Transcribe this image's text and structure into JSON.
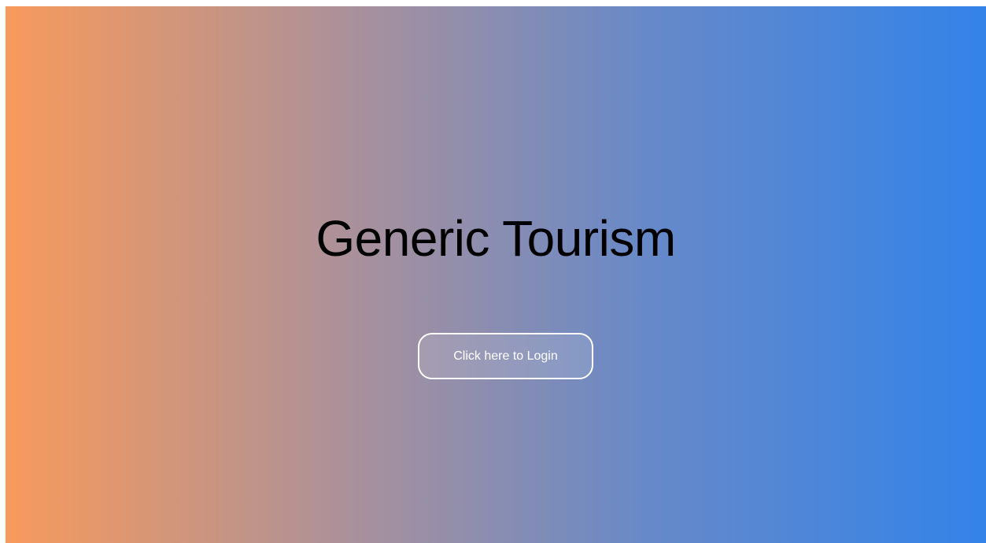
{
  "hero": {
    "title": "Generic Tourism",
    "login_label": "Click here to Login"
  },
  "theme": {
    "gradient_start": "#f89a5c",
    "gradient_end": "#3383e9",
    "button_border": "#ffffff",
    "title_color": "#000000"
  }
}
